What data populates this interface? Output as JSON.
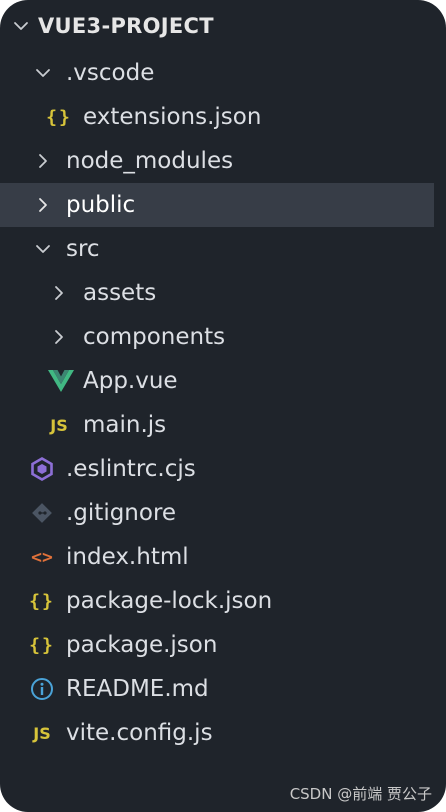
{
  "explorer": {
    "project_title": "VUE3-PROJECT",
    "items": [
      {
        "label": ".vscode",
        "kind": "folder",
        "expanded": true
      },
      {
        "label": "extensions.json",
        "kind": "json-file"
      },
      {
        "label": "node_modules",
        "kind": "folder",
        "expanded": false
      },
      {
        "label": "public",
        "kind": "folder",
        "expanded": false,
        "selected": true
      },
      {
        "label": "src",
        "kind": "folder",
        "expanded": true
      },
      {
        "label": "assets",
        "kind": "folder",
        "expanded": false
      },
      {
        "label": "components",
        "kind": "folder",
        "expanded": false
      },
      {
        "label": "App.vue",
        "kind": "vue-file"
      },
      {
        "label": "main.js",
        "kind": "js-file"
      },
      {
        "label": ".eslintrc.cjs",
        "kind": "eslint-file"
      },
      {
        "label": ".gitignore",
        "kind": "git-file"
      },
      {
        "label": "index.html",
        "kind": "html-file"
      },
      {
        "label": "package-lock.json",
        "kind": "json-file"
      },
      {
        "label": "package.json",
        "kind": "json-file"
      },
      {
        "label": "README.md",
        "kind": "info-file"
      },
      {
        "label": "vite.config.js",
        "kind": "js-file"
      }
    ]
  },
  "icons": {
    "braces_glyph": "{}",
    "js_glyph": "JS",
    "html_glyph": "<>"
  },
  "colors": {
    "background": "#1f242b",
    "selected_row": "#373d47",
    "text": "#dcdfe4",
    "json_yellow": "#d7c43a",
    "vue_green": "#41b883",
    "eslint_purple": "#8d6fd6",
    "html_orange": "#e0713a",
    "info_blue": "#4aa3d8"
  },
  "watermark": "CSDN @前端 贾公子"
}
